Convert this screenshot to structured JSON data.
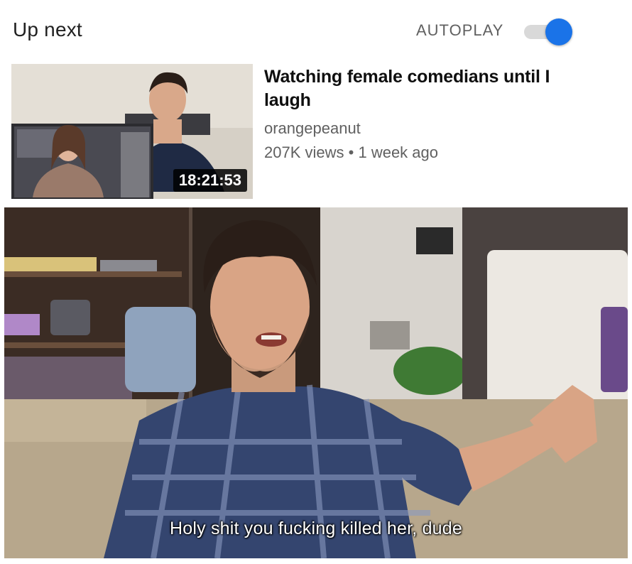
{
  "upnext": {
    "title": "Up next",
    "autoplay_label": "AUTOPLAY",
    "autoplay_on": true,
    "accent_color": "#1a73e8"
  },
  "video": {
    "title": "Watching female comedians until I laugh",
    "channel": "orangepeanut",
    "views": "207K views",
    "separator": "•",
    "age": "1 week ago",
    "duration": "18:21:53"
  },
  "meme": {
    "subtitle": "Holy shit you fucking killed her, dude"
  }
}
